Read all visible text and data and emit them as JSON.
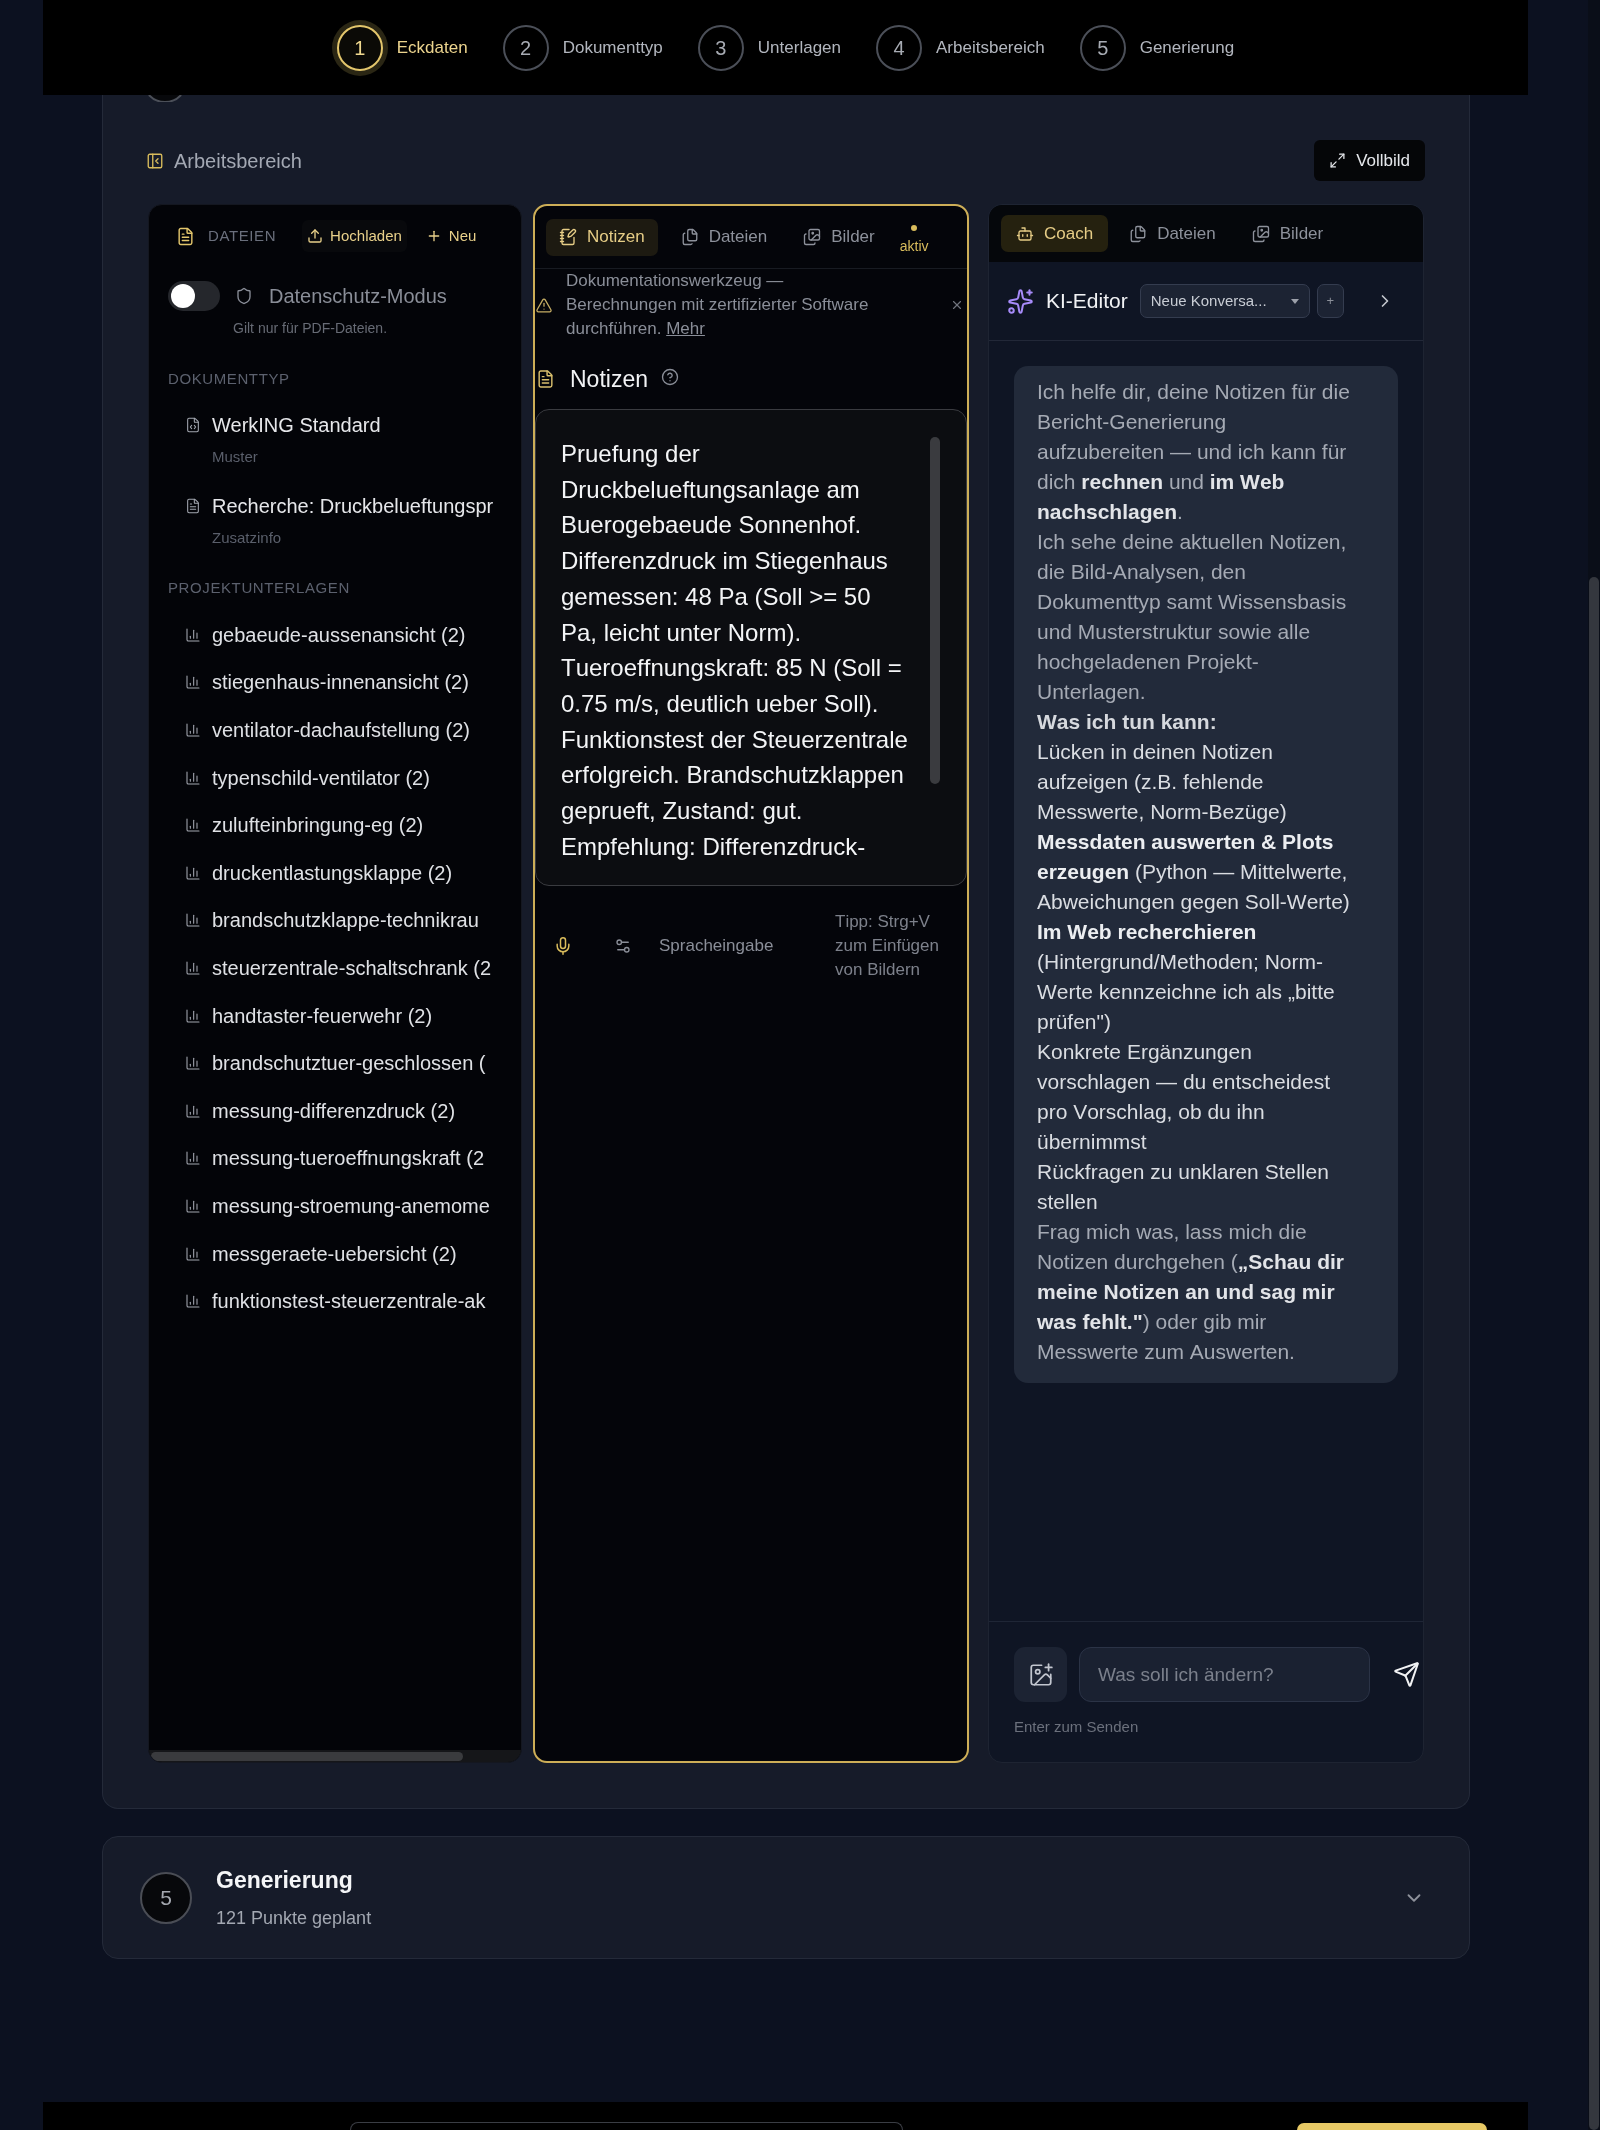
{
  "stepper": {
    "steps": [
      {
        "number": "1",
        "label": "Eckdaten",
        "selected": true
      },
      {
        "number": "2",
        "label": "Dokumenttyp",
        "selected": false
      },
      {
        "number": "3",
        "label": "Unterlagen",
        "selected": false
      },
      {
        "number": "4",
        "label": "Arbeitsbereich",
        "selected": false
      },
      {
        "number": "5",
        "label": "Generierung",
        "selected": false
      }
    ]
  },
  "workspace": {
    "title": "Arbeitsbereich",
    "fullscreen_button": "Vollbild"
  },
  "files_panel": {
    "header": "DATEIEN",
    "upload_button": "Hochladen",
    "new_button": "Neu",
    "privacy_toggle": {
      "label": "Datenschutz-Modus",
      "on": false,
      "hint": "Gilt nur für PDF-Dateien."
    },
    "sections": [
      {
        "title": "DOKUMENTTYP",
        "items": [
          {
            "kind": "template",
            "name": "WerkING Standard",
            "tag": "Muster"
          },
          {
            "kind": "document",
            "name": "Recherche: Druckbelueftungspr",
            "tag": "Zusatzinfo"
          }
        ]
      },
      {
        "title": "PROJEKTUNTERLAGEN",
        "items": [
          {
            "kind": "chart",
            "name": "gebaeude-aussenansicht (2)"
          },
          {
            "kind": "chart",
            "name": "stiegenhaus-innenansicht (2)"
          },
          {
            "kind": "chart",
            "name": "ventilator-dachaufstellung (2)"
          },
          {
            "kind": "chart",
            "name": "typenschild-ventilator (2)"
          },
          {
            "kind": "chart",
            "name": "zulufteinbringung-eg (2)"
          },
          {
            "kind": "chart",
            "name": "druckentlastungsklappe (2)"
          },
          {
            "kind": "chart",
            "name": "brandschutzklappe-technikrau"
          },
          {
            "kind": "chart",
            "name": "steuerzentrale-schaltschrank (2"
          },
          {
            "kind": "chart",
            "name": "handtaster-feuerwehr (2)"
          },
          {
            "kind": "chart",
            "name": "brandschutztuer-geschlossen ("
          },
          {
            "kind": "chart",
            "name": "messung-differenzdruck (2)"
          },
          {
            "kind": "chart",
            "name": "messung-tueroeffnungskraft (2"
          },
          {
            "kind": "chart",
            "name": "messung-stroemung-anemome"
          },
          {
            "kind": "chart",
            "name": "messgeraete-uebersicht (2)"
          },
          {
            "kind": "chart",
            "name": "funktionstest-steuerzentrale-ak"
          }
        ]
      }
    ]
  },
  "notes_panel": {
    "tabs": [
      {
        "kind": "notes",
        "label": "Notizen",
        "selected": true
      },
      {
        "kind": "files",
        "label": "Dateien",
        "selected": false
      },
      {
        "kind": "images",
        "label": "Bilder",
        "selected": false
      }
    ],
    "status": "aktiv",
    "warning": {
      "text": "Dokumentationswerkzeug — Berechnungen mit zertifizierter Software durchführen.",
      "link": "Mehr"
    },
    "title": "Notizen",
    "notes": {
      "value": "Pruefung der Druckbelueftungsanlage am Buerogebaeude Sonnenhof. Differenzdruck im Stiegenhaus gemessen: 48 Pa (Soll >= 50 Pa, leicht unter Norm). Tueroeffnungskraft: 85 N (Soll = 0.75 m/s, deutlich ueber Soll). Funktionstest der Steuerzentrale erfolgreich. Brandschutzklappen geprueft, Zustand: gut. Empfehlung: Differenzdruck-"
    },
    "voice_input": "Spracheingabe",
    "tip": "Tipp: Strg+V zum Einfügen von Bildern"
  },
  "coach_panel": {
    "tabs": [
      {
        "kind": "coach",
        "label": "Coach",
        "selected": true
      },
      {
        "kind": "files",
        "label": "Dateien",
        "selected": false
      },
      {
        "kind": "images",
        "label": "Bilder",
        "selected": false
      }
    ],
    "title": "KI-Editor",
    "conversation_select": "Neue Konversa...",
    "new_conversation_button": "+",
    "message": [
      {
        "kind": "paragraph",
        "text": "Ich helfe dir, deine Notizen für die Bericht-Generierung aufzubereiten — und ich kann für dich **rechnen** und **im Web nachschlagen**."
      },
      {
        "kind": "paragraph",
        "text": "Ich sehe deine aktuellen Notizen, die Bild-Analysen, den Dokumenttyp samt Wissensbasis und Musterstruktur sowie alle hochgeladenen Projekt-Unterlagen."
      },
      {
        "kind": "heading",
        "text": "Was ich tun kann:"
      },
      {
        "kind": "list_item",
        "text": "Lücken in deinen Notizen aufzeigen (z.B. fehlende Messwerte, Norm-Bezüge)"
      },
      {
        "kind": "list_item",
        "text": "**Messdaten auswerten & Plots erzeugen** (Python — Mittelwerte, Abweichungen gegen Soll-Werte)"
      },
      {
        "kind": "list_item",
        "text": "**Im Web recherchieren** (Hintergrund/Methoden; Norm-Werte kennzeichne ich als „bitte prüfen\")"
      },
      {
        "kind": "list_item",
        "text": "Konkrete Ergänzungen vorschlagen — du entscheidest pro Vorschlag, ob du ihn übernimmst"
      },
      {
        "kind": "list_item",
        "text": "Rückfragen zu unklaren Stellen stellen"
      },
      {
        "kind": "paragraph",
        "text": "Frag mich was, lass mich die Notizen durchgehen (**„Schau dir meine Notizen an und sag mir was fehlt.\"**) oder gib mir Messwerte zum Auswerten."
      }
    ],
    "input": {
      "placeholder": "Was soll ich ändern?"
    },
    "hint": "Enter zum Senden"
  },
  "next_step": {
    "number": "5",
    "title": "Generierung",
    "subtitle": "121 Punkte geplant",
    "expanded": false
  }
}
